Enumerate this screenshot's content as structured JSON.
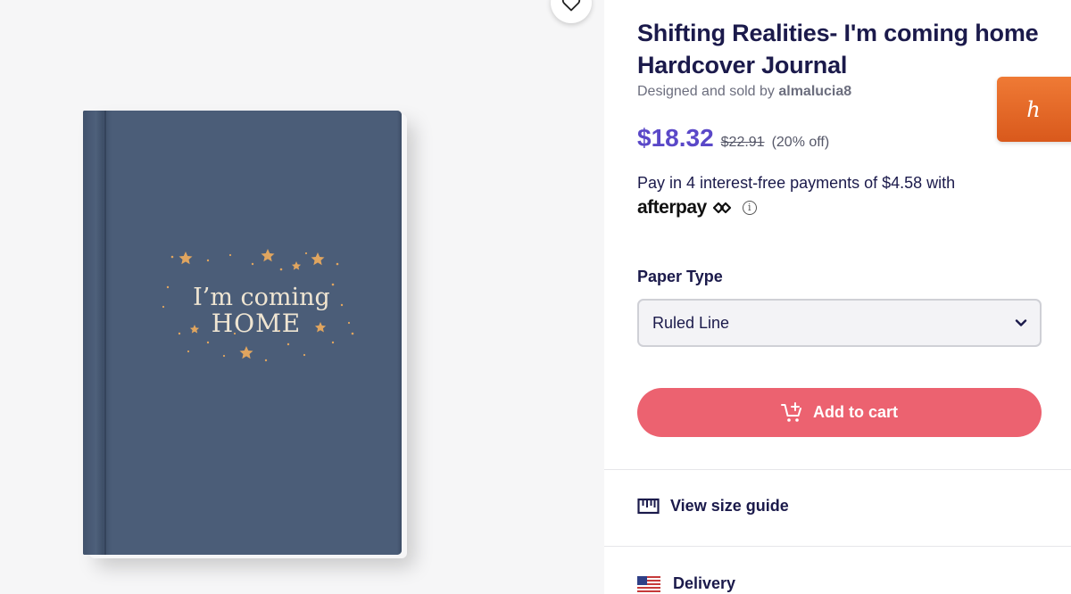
{
  "product": {
    "title": "Shifting Realities- I'm coming home Hardcover Journal",
    "seller_prefix": "Designed and sold by",
    "seller_name": "almalucia8",
    "cover_text_line1": "I’m coming",
    "cover_text_line2": "HOME"
  },
  "pricing": {
    "price": "$18.32",
    "original_price": "$22.91",
    "discount": "(20% off)"
  },
  "afterpay": {
    "text": "Pay in 4 interest-free payments of $4.58 with",
    "logo": "afterpay",
    "info_glyph": "i"
  },
  "options": {
    "paper_type_label": "Paper Type",
    "paper_type_value": "Ruled Line"
  },
  "actions": {
    "add_to_cart": "Add to cart",
    "size_guide": "View size guide",
    "delivery": "Delivery"
  },
  "extensions": {
    "honey_glyph": "h"
  },
  "colors": {
    "accent_price": "#5a48c8",
    "cart_button": "#ec6270",
    "journal_cover": "#4b5d78",
    "honey": "#e2662a"
  },
  "icons": [
    "heart-icon",
    "cart-plus-icon",
    "chevron-down-icon",
    "ruler-icon",
    "us-flag-icon",
    "info-icon",
    "star-icon"
  ]
}
